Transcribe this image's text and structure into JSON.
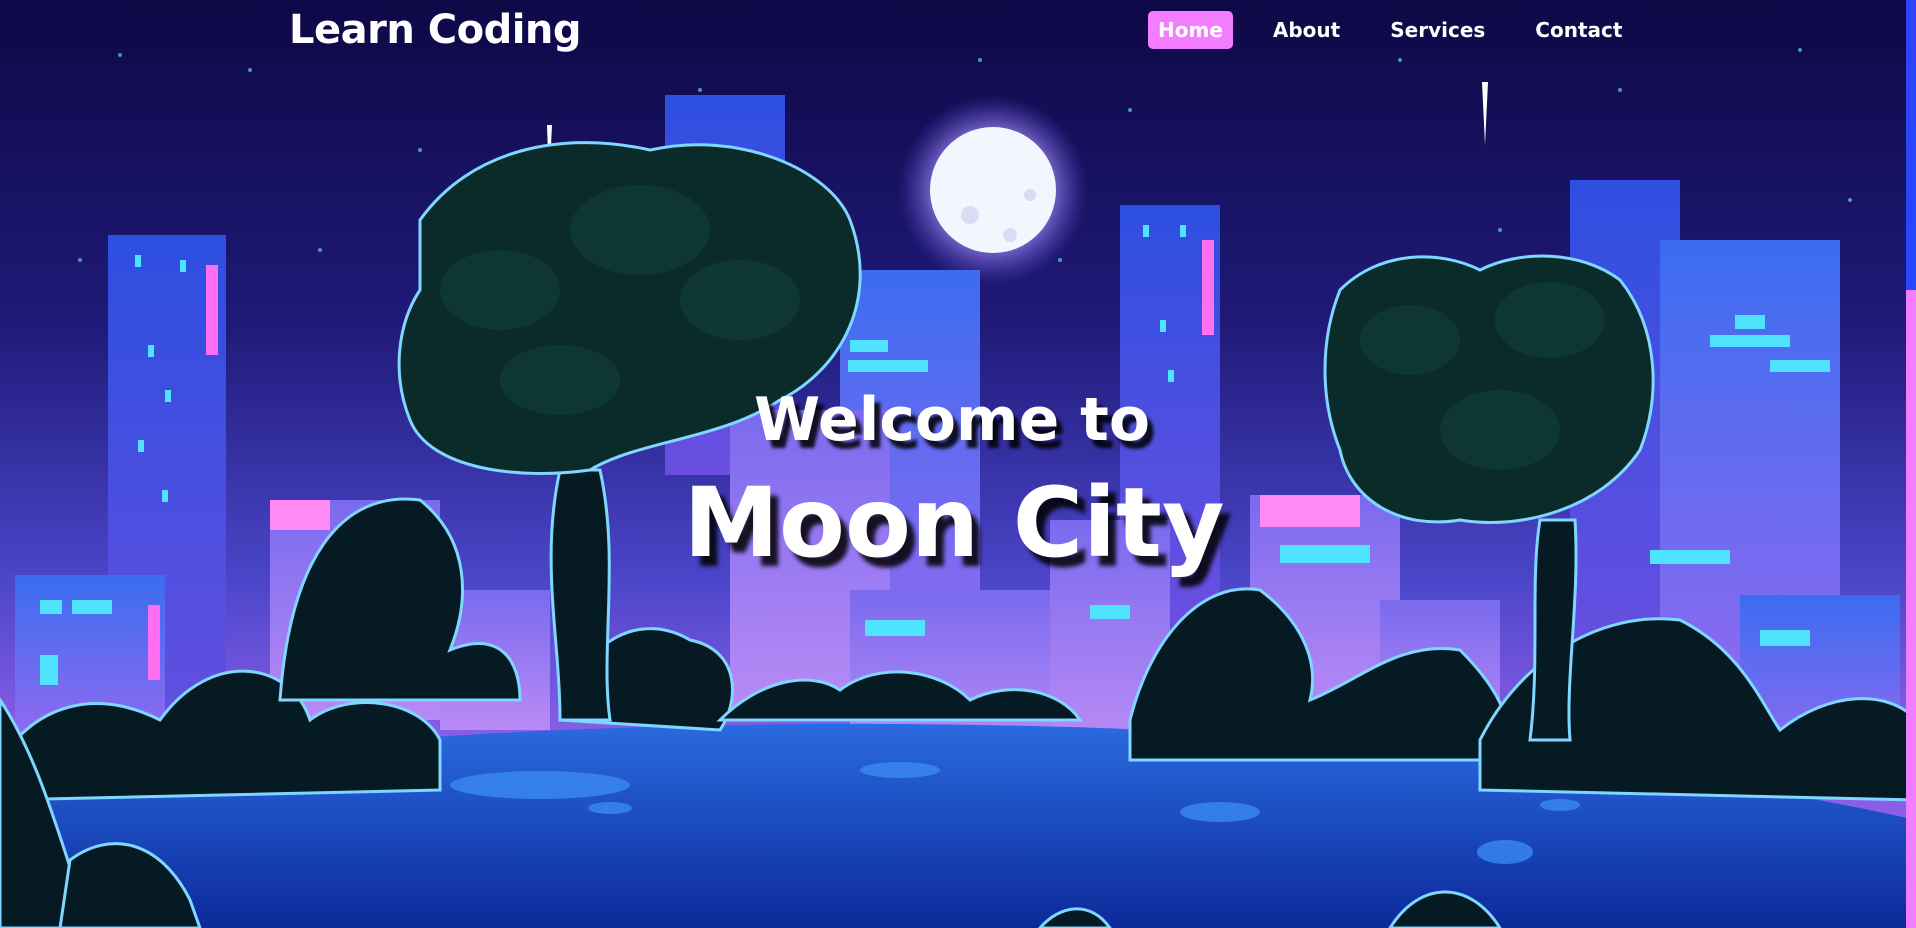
{
  "header": {
    "logo": "Learn Coding",
    "nav": [
      {
        "label": "Home",
        "active": true
      },
      {
        "label": "About",
        "active": false
      },
      {
        "label": "Services",
        "active": false
      },
      {
        "label": "Contact",
        "active": false
      }
    ]
  },
  "hero": {
    "line1": "Welcome to",
    "line2": "Moon City"
  },
  "colors": {
    "sky_top": "#0e0846",
    "sky_mid": "#2a2a9c",
    "sky_low": "#7a5fe0",
    "accent_pink": "#f27dff",
    "ground": "#1a4ec8",
    "foliage": "#061a24"
  },
  "icons": [
    "moon-icon"
  ]
}
